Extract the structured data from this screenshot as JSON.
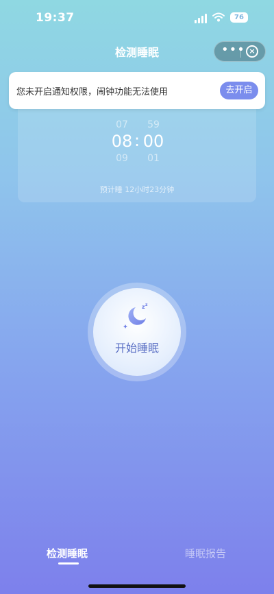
{
  "status_bar": {
    "time": "19:37",
    "battery": "76"
  },
  "nav": {
    "title": "检测睡眠"
  },
  "banner": {
    "text": "您未开启通知权限，闹钟功能无法使用",
    "button": "去开启"
  },
  "alarm": {
    "prev_hour": "07",
    "prev_minute": "59",
    "hour": "08",
    "separator": ":",
    "minute": "00",
    "next_hour": "09",
    "next_minute": "01",
    "estimate": "预计睡 12小时23分钟"
  },
  "start": {
    "label": "开始睡眠"
  },
  "tabs": [
    {
      "label": "检测睡眠",
      "active": true
    },
    {
      "label": "睡眠报告",
      "active": false
    }
  ],
  "colors": {
    "accent": "#7b8ded",
    "start_text": "#5a6fc4"
  }
}
